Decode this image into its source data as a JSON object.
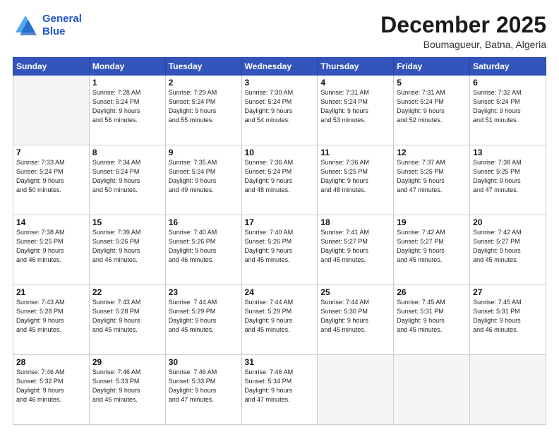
{
  "header": {
    "logo_line1": "General",
    "logo_line2": "Blue",
    "month": "December 2025",
    "location": "Boumagueur, Batna, Algeria"
  },
  "days_of_week": [
    "Sunday",
    "Monday",
    "Tuesday",
    "Wednesday",
    "Thursday",
    "Friday",
    "Saturday"
  ],
  "weeks": [
    [
      {
        "day": "",
        "text": ""
      },
      {
        "day": "1",
        "text": "Sunrise: 7:28 AM\nSunset: 5:24 PM\nDaylight: 9 hours\nand 56 minutes."
      },
      {
        "day": "2",
        "text": "Sunrise: 7:29 AM\nSunset: 5:24 PM\nDaylight: 9 hours\nand 55 minutes."
      },
      {
        "day": "3",
        "text": "Sunrise: 7:30 AM\nSunset: 5:24 PM\nDaylight: 9 hours\nand 54 minutes."
      },
      {
        "day": "4",
        "text": "Sunrise: 7:31 AM\nSunset: 5:24 PM\nDaylight: 9 hours\nand 53 minutes."
      },
      {
        "day": "5",
        "text": "Sunrise: 7:31 AM\nSunset: 5:24 PM\nDaylight: 9 hours\nand 52 minutes."
      },
      {
        "day": "6",
        "text": "Sunrise: 7:32 AM\nSunset: 5:24 PM\nDaylight: 9 hours\nand 51 minutes."
      }
    ],
    [
      {
        "day": "7",
        "text": "Sunrise: 7:33 AM\nSunset: 5:24 PM\nDaylight: 9 hours\nand 50 minutes."
      },
      {
        "day": "8",
        "text": "Sunrise: 7:34 AM\nSunset: 5:24 PM\nDaylight: 9 hours\nand 50 minutes."
      },
      {
        "day": "9",
        "text": "Sunrise: 7:35 AM\nSunset: 5:24 PM\nDaylight: 9 hours\nand 49 minutes."
      },
      {
        "day": "10",
        "text": "Sunrise: 7:36 AM\nSunset: 5:24 PM\nDaylight: 9 hours\nand 48 minutes."
      },
      {
        "day": "11",
        "text": "Sunrise: 7:36 AM\nSunset: 5:25 PM\nDaylight: 9 hours\nand 48 minutes."
      },
      {
        "day": "12",
        "text": "Sunrise: 7:37 AM\nSunset: 5:25 PM\nDaylight: 9 hours\nand 47 minutes."
      },
      {
        "day": "13",
        "text": "Sunrise: 7:38 AM\nSunset: 5:25 PM\nDaylight: 9 hours\nand 47 minutes."
      }
    ],
    [
      {
        "day": "14",
        "text": "Sunrise: 7:38 AM\nSunset: 5:25 PM\nDaylight: 9 hours\nand 46 minutes."
      },
      {
        "day": "15",
        "text": "Sunrise: 7:39 AM\nSunset: 5:26 PM\nDaylight: 9 hours\nand 46 minutes."
      },
      {
        "day": "16",
        "text": "Sunrise: 7:40 AM\nSunset: 5:26 PM\nDaylight: 9 hours\nand 46 minutes."
      },
      {
        "day": "17",
        "text": "Sunrise: 7:40 AM\nSunset: 5:26 PM\nDaylight: 9 hours\nand 45 minutes."
      },
      {
        "day": "18",
        "text": "Sunrise: 7:41 AM\nSunset: 5:27 PM\nDaylight: 9 hours\nand 45 minutes."
      },
      {
        "day": "19",
        "text": "Sunrise: 7:42 AM\nSunset: 5:27 PM\nDaylight: 9 hours\nand 45 minutes."
      },
      {
        "day": "20",
        "text": "Sunrise: 7:42 AM\nSunset: 5:27 PM\nDaylight: 9 hours\nand 45 minutes."
      }
    ],
    [
      {
        "day": "21",
        "text": "Sunrise: 7:43 AM\nSunset: 5:28 PM\nDaylight: 9 hours\nand 45 minutes."
      },
      {
        "day": "22",
        "text": "Sunrise: 7:43 AM\nSunset: 5:28 PM\nDaylight: 9 hours\nand 45 minutes."
      },
      {
        "day": "23",
        "text": "Sunrise: 7:44 AM\nSunset: 5:29 PM\nDaylight: 9 hours\nand 45 minutes."
      },
      {
        "day": "24",
        "text": "Sunrise: 7:44 AM\nSunset: 5:29 PM\nDaylight: 9 hours\nand 45 minutes."
      },
      {
        "day": "25",
        "text": "Sunrise: 7:44 AM\nSunset: 5:30 PM\nDaylight: 9 hours\nand 45 minutes."
      },
      {
        "day": "26",
        "text": "Sunrise: 7:45 AM\nSunset: 5:31 PM\nDaylight: 9 hours\nand 45 minutes."
      },
      {
        "day": "27",
        "text": "Sunrise: 7:45 AM\nSunset: 5:31 PM\nDaylight: 9 hours\nand 46 minutes."
      }
    ],
    [
      {
        "day": "28",
        "text": "Sunrise: 7:46 AM\nSunset: 5:32 PM\nDaylight: 9 hours\nand 46 minutes."
      },
      {
        "day": "29",
        "text": "Sunrise: 7:46 AM\nSunset: 5:33 PM\nDaylight: 9 hours\nand 46 minutes."
      },
      {
        "day": "30",
        "text": "Sunrise: 7:46 AM\nSunset: 5:33 PM\nDaylight: 9 hours\nand 47 minutes."
      },
      {
        "day": "31",
        "text": "Sunrise: 7:46 AM\nSunset: 5:34 PM\nDaylight: 9 hours\nand 47 minutes."
      },
      {
        "day": "",
        "text": ""
      },
      {
        "day": "",
        "text": ""
      },
      {
        "day": "",
        "text": ""
      }
    ]
  ]
}
